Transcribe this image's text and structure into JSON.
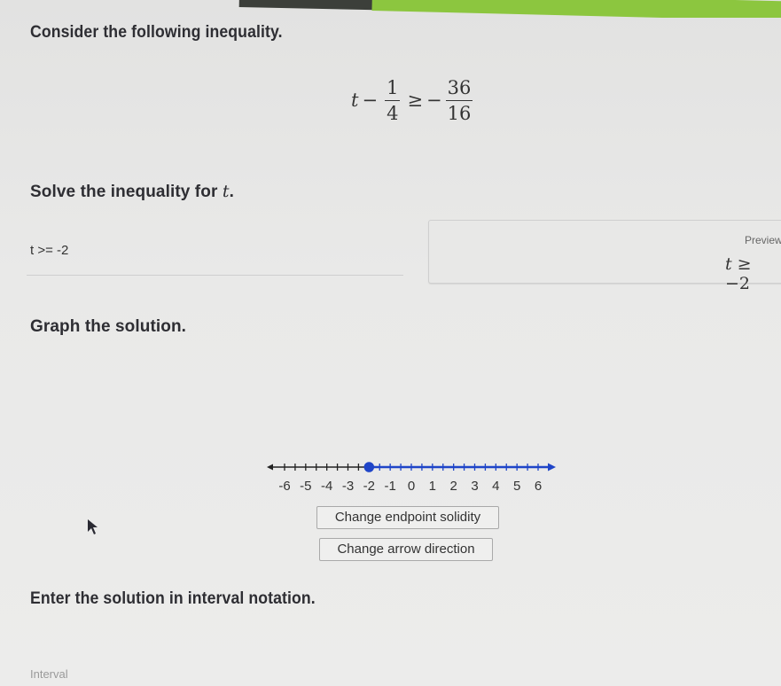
{
  "question": {
    "intro": "Consider the following inequality.",
    "inequality": {
      "variable": "t",
      "minus": "−",
      "frac1_num": "1",
      "frac1_den": "4",
      "relation": "≥",
      "neg": "−",
      "frac2_num": "36",
      "frac2_den": "16"
    }
  },
  "solve": {
    "prompt_prefix": "Solve the inequality for ",
    "prompt_var": "t",
    "prompt_suffix": ".",
    "input_value": "t >= -2",
    "preview_label": "Preview",
    "preview_var": "t",
    "preview_rest": " ≥ −2"
  },
  "graph": {
    "prompt": "Graph the solution.",
    "number_line": {
      "min": -6,
      "max": 6,
      "tick_step": 0.5,
      "labels": [
        "-6",
        "-5",
        "-4",
        "-3",
        "-2",
        "-1",
        "0",
        "1",
        "2",
        "3",
        "4",
        "5",
        "6"
      ],
      "endpoint": -2,
      "endpoint_solid": true,
      "arrow_direction": "right",
      "shade_color": "#1f45c8",
      "axis_color": "#222222"
    },
    "buttons": {
      "solidity": "Change endpoint solidity",
      "direction": "Change arrow direction"
    }
  },
  "interval": {
    "prompt": "Enter the solution in interval notation.",
    "placeholder": "Interval"
  },
  "colors": {
    "accent_green": "#8cc63f",
    "graph_blue": "#1f45c8"
  }
}
